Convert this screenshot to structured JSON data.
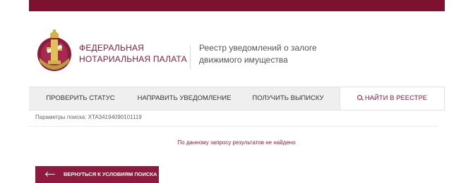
{
  "header": {
    "org_name_line1": "Федеральная",
    "org_name_line2": "нотариальная палата",
    "registry_title_line1": "Реестр уведомлений о залоге",
    "registry_title_line2": "движимого имущества"
  },
  "nav": {
    "tabs": [
      {
        "label": "Проверить статус",
        "active": false
      },
      {
        "label": "Направить уведомление",
        "active": false
      },
      {
        "label": "Получить выписку",
        "active": false
      },
      {
        "label": "Найти в реестре",
        "active": true,
        "icon": "search-icon"
      }
    ]
  },
  "search": {
    "params_label": "Параметры поиска: XTA34194090101119",
    "no_results": "По данному запросу результатов не найдено"
  },
  "actions": {
    "back_label": "Вернуться к условиям поиска",
    "back_icon": "arrow-left-icon"
  },
  "colors": {
    "brand": "#8e1a3d",
    "topbar": "#7d1230",
    "nav_bg": "#efefef"
  }
}
